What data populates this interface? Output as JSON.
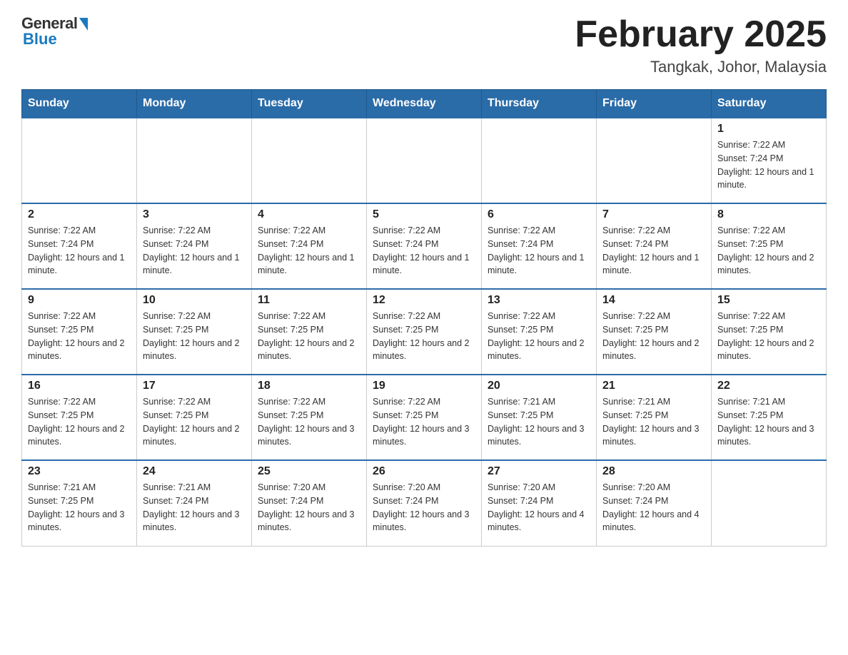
{
  "header": {
    "logo": {
      "general": "General",
      "blue": "Blue"
    },
    "title": "February 2025",
    "location": "Tangkak, Johor, Malaysia"
  },
  "days_of_week": [
    "Sunday",
    "Monday",
    "Tuesday",
    "Wednesday",
    "Thursday",
    "Friday",
    "Saturday"
  ],
  "weeks": [
    [
      null,
      null,
      null,
      null,
      null,
      null,
      {
        "day": 1,
        "sunrise": "Sunrise: 7:22 AM",
        "sunset": "Sunset: 7:24 PM",
        "daylight": "Daylight: 12 hours and 1 minute."
      }
    ],
    [
      {
        "day": 2,
        "sunrise": "Sunrise: 7:22 AM",
        "sunset": "Sunset: 7:24 PM",
        "daylight": "Daylight: 12 hours and 1 minute."
      },
      {
        "day": 3,
        "sunrise": "Sunrise: 7:22 AM",
        "sunset": "Sunset: 7:24 PM",
        "daylight": "Daylight: 12 hours and 1 minute."
      },
      {
        "day": 4,
        "sunrise": "Sunrise: 7:22 AM",
        "sunset": "Sunset: 7:24 PM",
        "daylight": "Daylight: 12 hours and 1 minute."
      },
      {
        "day": 5,
        "sunrise": "Sunrise: 7:22 AM",
        "sunset": "Sunset: 7:24 PM",
        "daylight": "Daylight: 12 hours and 1 minute."
      },
      {
        "day": 6,
        "sunrise": "Sunrise: 7:22 AM",
        "sunset": "Sunset: 7:24 PM",
        "daylight": "Daylight: 12 hours and 1 minute."
      },
      {
        "day": 7,
        "sunrise": "Sunrise: 7:22 AM",
        "sunset": "Sunset: 7:24 PM",
        "daylight": "Daylight: 12 hours and 1 minute."
      },
      {
        "day": 8,
        "sunrise": "Sunrise: 7:22 AM",
        "sunset": "Sunset: 7:25 PM",
        "daylight": "Daylight: 12 hours and 2 minutes."
      }
    ],
    [
      {
        "day": 9,
        "sunrise": "Sunrise: 7:22 AM",
        "sunset": "Sunset: 7:25 PM",
        "daylight": "Daylight: 12 hours and 2 minutes."
      },
      {
        "day": 10,
        "sunrise": "Sunrise: 7:22 AM",
        "sunset": "Sunset: 7:25 PM",
        "daylight": "Daylight: 12 hours and 2 minutes."
      },
      {
        "day": 11,
        "sunrise": "Sunrise: 7:22 AM",
        "sunset": "Sunset: 7:25 PM",
        "daylight": "Daylight: 12 hours and 2 minutes."
      },
      {
        "day": 12,
        "sunrise": "Sunrise: 7:22 AM",
        "sunset": "Sunset: 7:25 PM",
        "daylight": "Daylight: 12 hours and 2 minutes."
      },
      {
        "day": 13,
        "sunrise": "Sunrise: 7:22 AM",
        "sunset": "Sunset: 7:25 PM",
        "daylight": "Daylight: 12 hours and 2 minutes."
      },
      {
        "day": 14,
        "sunrise": "Sunrise: 7:22 AM",
        "sunset": "Sunset: 7:25 PM",
        "daylight": "Daylight: 12 hours and 2 minutes."
      },
      {
        "day": 15,
        "sunrise": "Sunrise: 7:22 AM",
        "sunset": "Sunset: 7:25 PM",
        "daylight": "Daylight: 12 hours and 2 minutes."
      }
    ],
    [
      {
        "day": 16,
        "sunrise": "Sunrise: 7:22 AM",
        "sunset": "Sunset: 7:25 PM",
        "daylight": "Daylight: 12 hours and 2 minutes."
      },
      {
        "day": 17,
        "sunrise": "Sunrise: 7:22 AM",
        "sunset": "Sunset: 7:25 PM",
        "daylight": "Daylight: 12 hours and 2 minutes."
      },
      {
        "day": 18,
        "sunrise": "Sunrise: 7:22 AM",
        "sunset": "Sunset: 7:25 PM",
        "daylight": "Daylight: 12 hours and 3 minutes."
      },
      {
        "day": 19,
        "sunrise": "Sunrise: 7:22 AM",
        "sunset": "Sunset: 7:25 PM",
        "daylight": "Daylight: 12 hours and 3 minutes."
      },
      {
        "day": 20,
        "sunrise": "Sunrise: 7:21 AM",
        "sunset": "Sunset: 7:25 PM",
        "daylight": "Daylight: 12 hours and 3 minutes."
      },
      {
        "day": 21,
        "sunrise": "Sunrise: 7:21 AM",
        "sunset": "Sunset: 7:25 PM",
        "daylight": "Daylight: 12 hours and 3 minutes."
      },
      {
        "day": 22,
        "sunrise": "Sunrise: 7:21 AM",
        "sunset": "Sunset: 7:25 PM",
        "daylight": "Daylight: 12 hours and 3 minutes."
      }
    ],
    [
      {
        "day": 23,
        "sunrise": "Sunrise: 7:21 AM",
        "sunset": "Sunset: 7:25 PM",
        "daylight": "Daylight: 12 hours and 3 minutes."
      },
      {
        "day": 24,
        "sunrise": "Sunrise: 7:21 AM",
        "sunset": "Sunset: 7:24 PM",
        "daylight": "Daylight: 12 hours and 3 minutes."
      },
      {
        "day": 25,
        "sunrise": "Sunrise: 7:20 AM",
        "sunset": "Sunset: 7:24 PM",
        "daylight": "Daylight: 12 hours and 3 minutes."
      },
      {
        "day": 26,
        "sunrise": "Sunrise: 7:20 AM",
        "sunset": "Sunset: 7:24 PM",
        "daylight": "Daylight: 12 hours and 3 minutes."
      },
      {
        "day": 27,
        "sunrise": "Sunrise: 7:20 AM",
        "sunset": "Sunset: 7:24 PM",
        "daylight": "Daylight: 12 hours and 4 minutes."
      },
      {
        "day": 28,
        "sunrise": "Sunrise: 7:20 AM",
        "sunset": "Sunset: 7:24 PM",
        "daylight": "Daylight: 12 hours and 4 minutes."
      },
      null
    ]
  ]
}
